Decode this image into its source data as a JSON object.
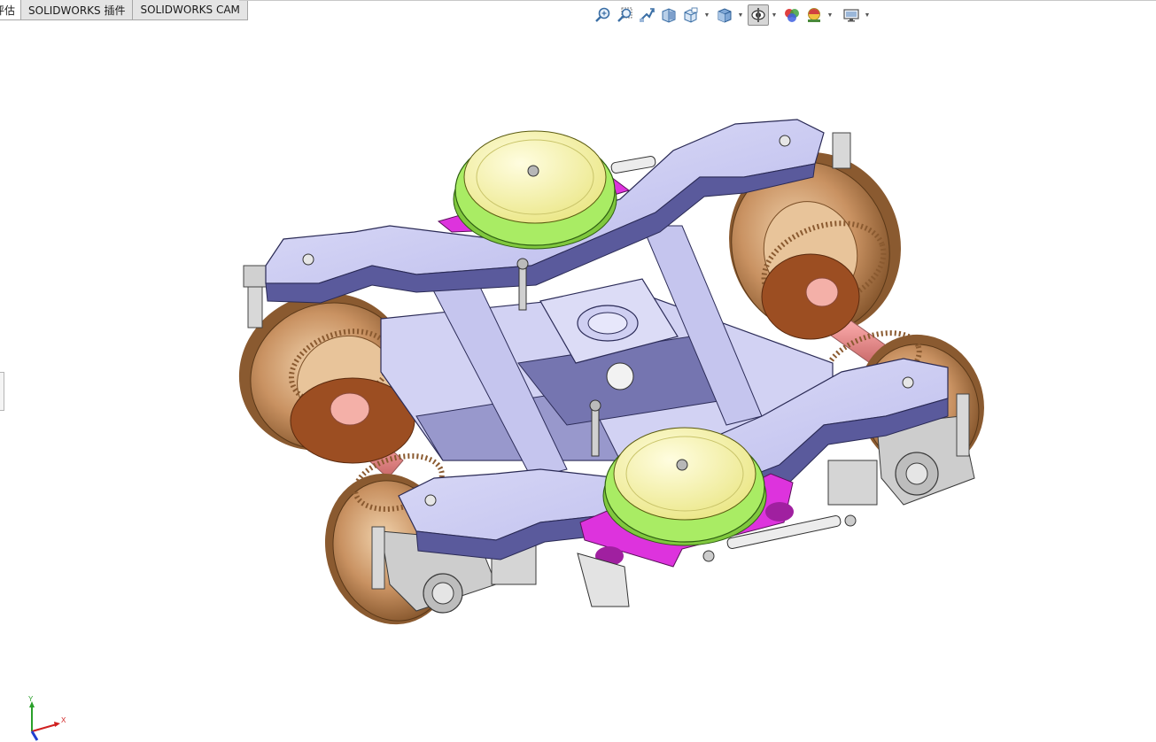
{
  "tabs": [
    {
      "label": "评估"
    },
    {
      "label": "SOLIDWORKS 插件"
    },
    {
      "label": "SOLIDWORKS CAM"
    }
  ],
  "view_toolbar": {
    "icons": [
      "zoom-to-fit-icon",
      "zoom-to-area-icon",
      "previous-view-icon",
      "section-view-icon",
      "view-orientation-icon",
      "display-style-icon",
      "hide-show-items-icon",
      "edit-appearance-icon",
      "apply-scene-icon",
      "view-settings-icon"
    ]
  },
  "triad": {
    "x_label": "X",
    "y_label": "Y"
  },
  "colors": {
    "frame": "#c7c7f2",
    "frame_dark": "#5a5a9c",
    "air_spring_top": "#f6f4a4",
    "air_spring_ring": "#a9ec64",
    "wheel": "#c98f5c",
    "wheel_hub": "#9a4a1c",
    "axle": "#f0a0a0",
    "magenta_link": "#dd33dd"
  }
}
